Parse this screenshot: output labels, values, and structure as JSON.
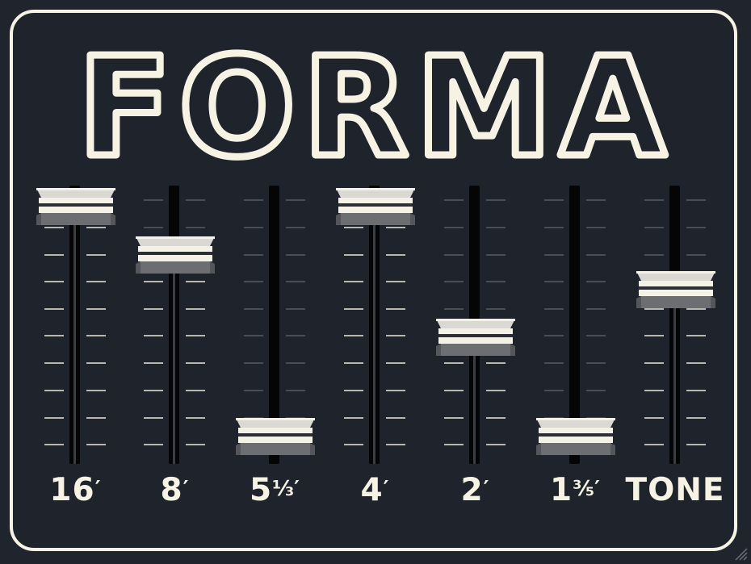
{
  "app": {
    "title": "FORMA"
  },
  "colors": {
    "background": "#1f232c",
    "border": "#f6f3e4",
    "text": "#f6f3e4",
    "track": "#050506",
    "cap_light": "#f4f2e6",
    "cap_dark": "#2c2f35"
  },
  "drawbars": [
    {
      "label": "16′",
      "main": "16",
      "frac": "",
      "mark": "′",
      "level": 1.0
    },
    {
      "label": "8′",
      "main": "8",
      "frac": "",
      "mark": "′",
      "level": 0.79
    },
    {
      "label": "5⅓′",
      "main": "5",
      "frac": "⅓",
      "mark": "′",
      "level": 0.0
    },
    {
      "label": "4′",
      "main": "4",
      "frac": "",
      "mark": "′",
      "level": 1.0
    },
    {
      "label": "2′",
      "main": "2",
      "frac": "",
      "mark": "′",
      "level": 0.43
    },
    {
      "label": "1⅗′",
      "main": "1",
      "frac": "⅗",
      "mark": "′",
      "level": 0.0
    },
    {
      "label": "TONE",
      "main": "TONE",
      "frac": "",
      "mark": "",
      "level": 0.64
    }
  ],
  "resize_handle": {
    "icon": "resize-grip-icon"
  }
}
